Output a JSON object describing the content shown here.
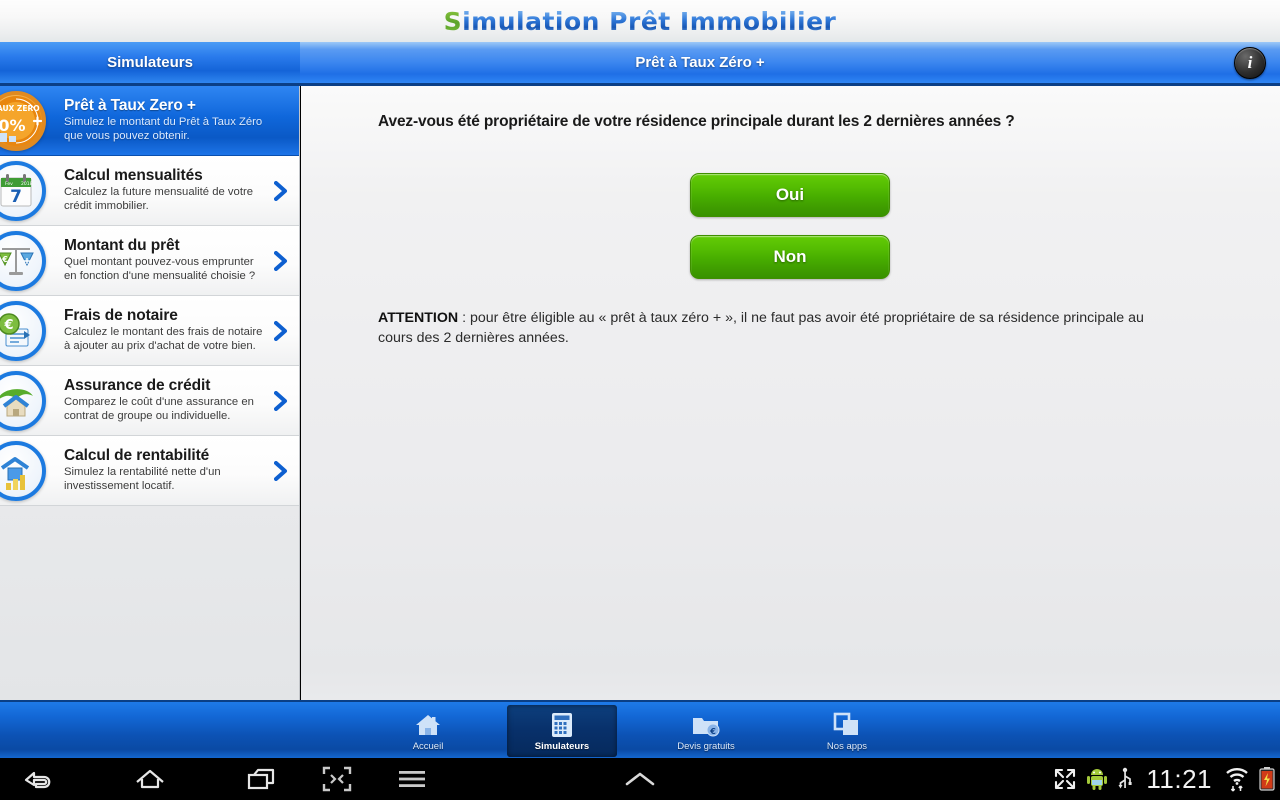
{
  "app": {
    "title_first_letter": "S",
    "title_rest": "imulation Prêt Immobilier"
  },
  "sidebar": {
    "header_title": "Simulateurs",
    "items": [
      {
        "title": "Prêt à Taux Zero +",
        "desc": "Simulez le montant du Prêt à Taux Zéro que vous pouvez obtenir.",
        "icon": "taux-zero-badge-icon",
        "selected": true
      },
      {
        "title": "Calcul mensualités",
        "desc": "Calculez la future mensualité de votre crédit immobilier.",
        "icon": "calendar-icon",
        "selected": false
      },
      {
        "title": "Montant du prêt",
        "desc": "Quel montant pouvez-vous emprunter en fonction d'une mensualité choisie ?",
        "icon": "balance-scale-icon",
        "selected": false
      },
      {
        "title": "Frais de notaire",
        "desc": "Calculez le montant des frais de notaire à ajouter au prix d'achat de votre bien.",
        "icon": "euro-document-icon",
        "selected": false
      },
      {
        "title": "Assurance de crédit",
        "desc": "Comparez le coût d'une assurance en contrat de groupe ou individuelle.",
        "icon": "umbrella-house-icon",
        "selected": false
      },
      {
        "title": "Calcul de rentabilité",
        "desc": "Simulez la rentabilité nette d'un investissement locatif.",
        "icon": "house-chart-icon",
        "selected": false
      }
    ]
  },
  "content": {
    "header_title": "Prêt à Taux Zéro +",
    "info_icon_label": "i",
    "question": "Avez-vous été propriétaire de votre résidence principale durant les 2 dernières années ?",
    "buttons": [
      {
        "label": "Oui"
      },
      {
        "label": "Non"
      }
    ],
    "attention_label": "ATTENTION",
    "attention_body": " : pour être éligible au « prêt à taux zéro + », il ne faut pas avoir été propriétaire de sa résidence principale au cours des 2 dernières années."
  },
  "bottom_nav": {
    "items": [
      {
        "label": "Accueil",
        "icon": "home-icon",
        "active": false
      },
      {
        "label": "Simulateurs",
        "icon": "calculator-icon",
        "active": true
      },
      {
        "label": "Devis gratuits",
        "icon": "folder-euro-icon",
        "active": false
      },
      {
        "label": "Nos apps",
        "icon": "windows-stack-icon",
        "active": false
      }
    ]
  },
  "system_bar": {
    "back_icon": "back-icon",
    "home_icon": "home-icon",
    "recents_icon": "recent-apps-icon",
    "screenshot_icon": "screen-capture-icon",
    "menu_icon": "menu-icon",
    "center_icon": "chevron-up-icon",
    "expand_icon": "expand-fullscreen-icon",
    "android_icon": "android-robot-icon",
    "usb_icon": "usb-icon",
    "clock": "11:21",
    "wifi_icon": "wifi-icon",
    "battery_icon": "battery-low-icon"
  },
  "colors": {
    "brand_blue": "#1464d8",
    "accent_green": "#47ad00",
    "selected_blue": "#0f67db",
    "badge_orange": "#f0971f"
  }
}
